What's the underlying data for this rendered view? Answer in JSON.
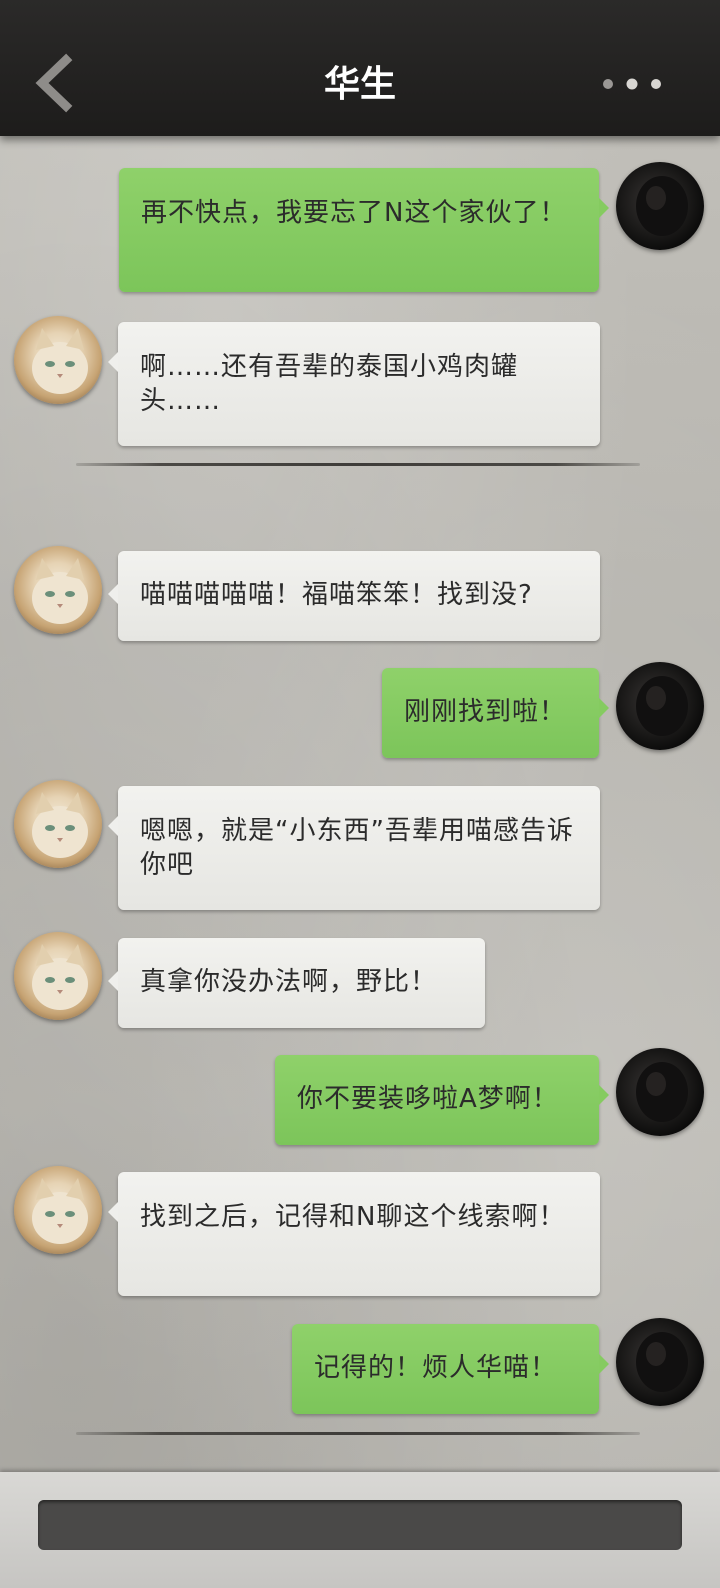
{
  "header": {
    "title": "华生",
    "back_icon": "chevron-left-icon",
    "more_icon": "more-dots-icon"
  },
  "colors": {
    "header_bg": "#232221",
    "incoming_bubble": "#ececE9",
    "outgoing_bubble": "#85cb60",
    "divider": "#3e3c39",
    "input_field": "#4a4948"
  },
  "messages": [
    {
      "side": "out",
      "text": "再不快点，我要忘了N这个家伙了！"
    },
    {
      "side": "in",
      "text": "啊……还有吾辈的泰国小鸡肉罐头……"
    },
    {
      "side": "in",
      "text": "喵喵喵喵喵！福喵笨笨！找到没?"
    },
    {
      "side": "out",
      "text": "刚刚找到啦！"
    },
    {
      "side": "in",
      "text": "嗯嗯，就是“小东西”吾辈用喵感告诉你吧"
    },
    {
      "side": "in",
      "text": "真拿你没办法啊，野比！"
    },
    {
      "side": "out",
      "text": "你不要装哆啦A梦啊！"
    },
    {
      "side": "in",
      "text": "找到之后，记得和N聊这个线索啊！"
    },
    {
      "side": "out",
      "text": "记得的！烦人华喵！"
    }
  ],
  "input": {
    "value": ""
  }
}
